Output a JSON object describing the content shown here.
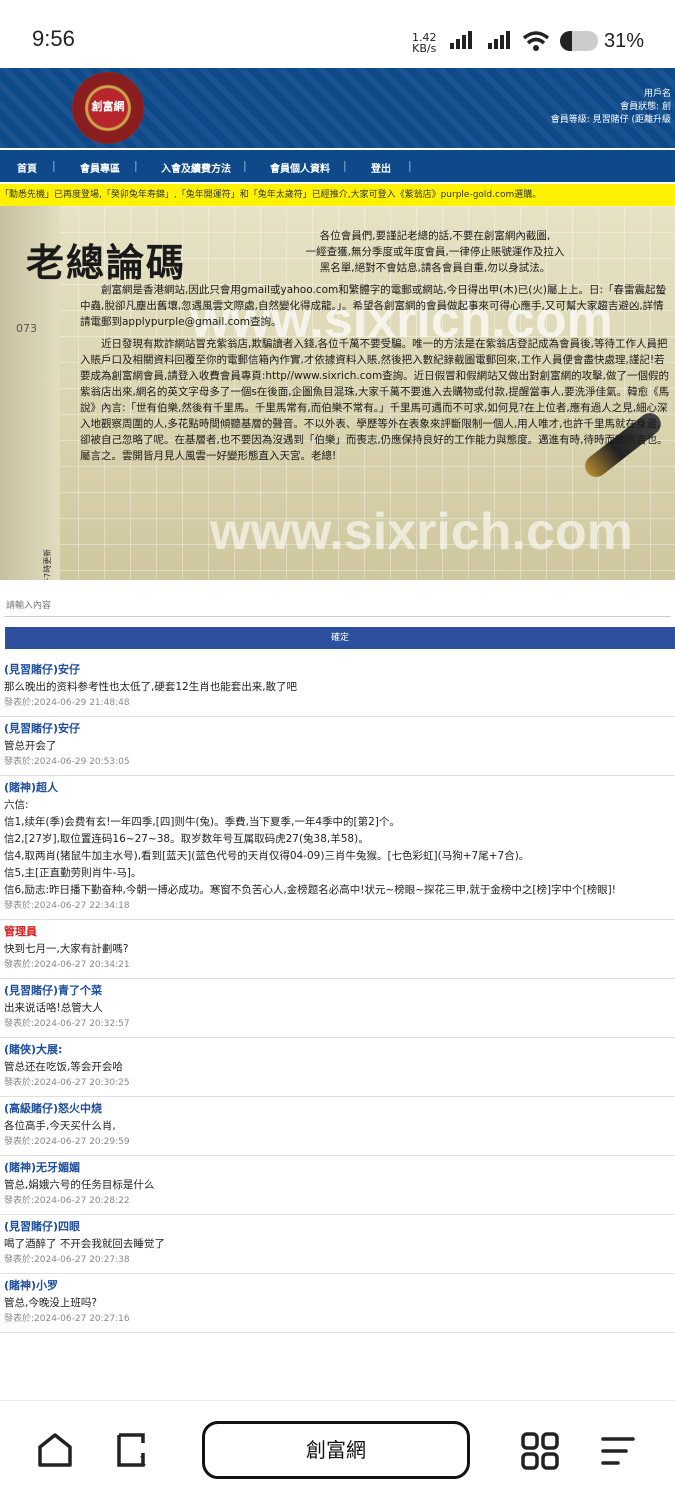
{
  "status_bar": {
    "time": "9:56",
    "speed_value": "1.42",
    "speed_unit": "KB/s",
    "battery": "31%",
    "battery_level": 0.31
  },
  "header": {
    "logo_text": "創富網",
    "user_line1": "用戶名",
    "user_line2": "會員狀態: 創",
    "user_line3": "會員等級: 見習賭仔 (距離升級"
  },
  "nav": {
    "items": [
      "首頁",
      "會員專區",
      "入會及續費方法",
      "會員個人資料",
      "登出"
    ]
  },
  "ticker": "「勳悉先機」已再度登場,「癸卯兔年寿錦」,「兔年開運符」和「兔年太歲符」已經推介,大家可登入《紫翁店》purple-gold.com選購。",
  "banner": {
    "title": "老總論碼",
    "watermark": "www.sixrich.com",
    "number": "073",
    "vertical_date": "2024年6月29日 下午7時更新",
    "para1a": "各位會員們,要謹記老總的話,不要在創富網內截圖,",
    "para1b": "一經查獲,無分季度或年度會員,一律停止賬號運作及拉入",
    "para1c": "黑名單,絕對不會姑息,請各會員自重,勿以身試法。",
    "para2": "創富網是香港網站,因此只會用gmail或yahoo.com和繁體字的電郵或網站,今日得出甲(木)已(火)屬上上。日:「春雷震起蟄中蟲,脫卻凡塵出舊壤,忽遇風雲文際處,自然變化得成龍。」。希望各創富網的會員做起事來可得心應手,又可幫大家趨吉避凶,詳情請電郵到applypurple@gmail.com查詢。",
    "para3": "近日發現有欺詐網站冒充紫翁店,欺騙讀者入錢,各位千萬不要受騙。唯一的方法是在紫翁店登記成為會員後,等待工作人員把入賬戶口及相關資料回覆至你的電郵信箱內作實,才依據資料入賬,然後把入數紀錄截圖電郵回來,工作人員便會盡快處理,謹記!若要成為創富網會員,請登入收費會員專頁:http//www.sixrich.com查詢。近日假冒和假網站又做出對創富網的攻擊,做了一個假的紫翁店出來,網名的英文字母多了一個s在後面,企圖魚目混珠,大家千萬不要進入去購物或付款,提醒當事人,要洗淨佳氣。韓愈《馬說》內言:「世有伯樂,然後有千里馬。千里馬常有,而伯樂不常有。」千里馬可遇而不可求,如何見?在上位者,應有過人之見,細心深入地觀察周圍的人,多花點時間傾聽基層的聲音。不以外表、學歷等外在表象來評斷限制一個人,用人唯才,也許千里馬就在身邊,卻被自己忽略了呢。在基層者,也不要因為沒遇到「伯樂」而喪志,仍應保持良好的工作能力與態度。邁進有時,待時而動則吉也。屬言之。雲開皆月見人風雲一好變形態直入天宮。老總!"
  },
  "search": {
    "placeholder": "請輸入內容",
    "submit_label": "確定"
  },
  "posts": [
    {
      "author": "(見習賭仔)安仔",
      "content": "那么晚出的资料参考性也太低了,硬套12生肖也能套出来,散了吧",
      "time": "發表於:2024-06-29 21:48:48"
    },
    {
      "author": "(見習賭仔)安仔",
      "content": "管总开会了",
      "time": "發表於:2024-06-29 20:53:05"
    },
    {
      "author": "(賭神)超人",
      "content": "六信:\n信1,续年(季)会费有玄!一年四季,[四]则牛(兔)。季費,当下夏季,一年4季中的[第2]个。\n信2,[27岁],取位置连码16~27~38。取岁数年号互属取码虎27(兔38,羊58)。\n信4,取两肖(猪鼠牛加主水号),看到[蓝天](蓝色代号的天肖仅得04-09)三肖牛兔猴。[七色彩虹](马狗+7尾+7合)。\n信5,主[正直勤劳則肖牛-马]。\n信6,励志:昨日播下勤奋种,今朝一搏必成功。寒窗不负苦心人,金榜题名必高中!状元~榜眼~探花三甲,就于金榜中之[榜]字中个[榜眼]!",
      "time": "發表於:2024-06-27 22:34:18"
    },
    {
      "author": "管理員",
      "admin": true,
      "content": "快到七月一,大家有計劃嗎?",
      "time": "發表於:2024-06-27 20:34:21"
    },
    {
      "author": "(見習賭仔)青了个菜",
      "content": "出来说话咯!总管大人",
      "time": "發表於:2024-06-27 20:32:57"
    },
    {
      "author": "(賭俠)大展:",
      "content": "管总还在吃饭,等会开会哈",
      "time": "發表於:2024-06-27 20:30:25"
    },
    {
      "author": "(高級賭仔)怒火中烧",
      "content": "各位高手,今天买什么肖,",
      "time": "發表於:2024-06-27 20:29:59"
    },
    {
      "author": "(賭神)无牙媚媚",
      "content": "管总,娟娥六号的任务目标是什么",
      "time": "發表於:2024-06-27 20:28:22"
    },
    {
      "author": "(見習賭仔)四眼",
      "content": "喝了酒醉了 不开会我就回去睡觉了",
      "time": "發表於:2024-06-27 20:27:38"
    },
    {
      "author": "(賭神)小罗",
      "content": "管总,今晚没上班吗?",
      "time": "發表於:2024-06-27 20:27:16"
    }
  ],
  "bottom_bar": {
    "title": "創富網",
    "icons": [
      "home-icon",
      "tabs-icon",
      "apps-grid-icon",
      "menu-icon"
    ]
  }
}
